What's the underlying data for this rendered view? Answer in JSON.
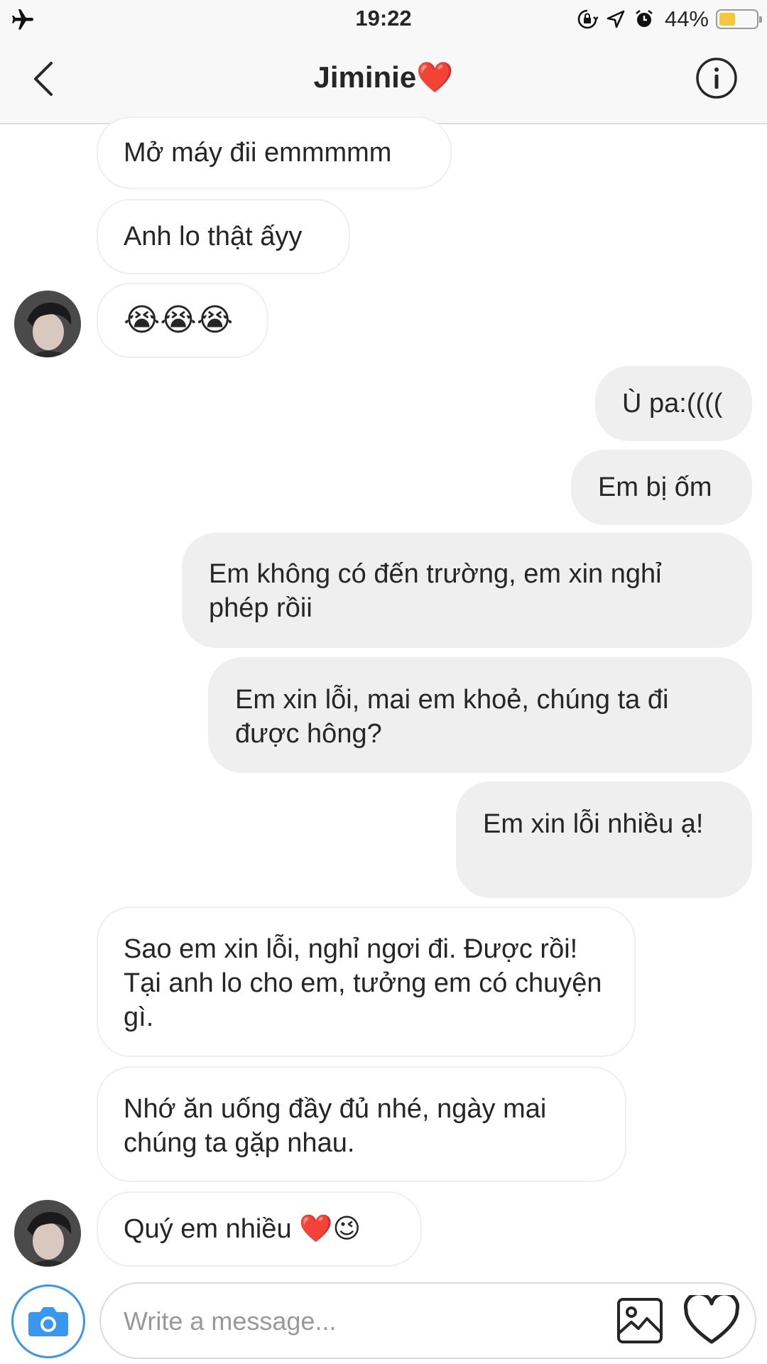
{
  "status_bar": {
    "time": "19:22",
    "battery_text": "44%",
    "battery_level": 0.44,
    "icons": [
      "airplane-icon",
      "orientation-lock-icon",
      "location-arrow-icon",
      "alarm-icon",
      "battery-icon"
    ]
  },
  "header": {
    "title": "Jiminie❤️",
    "back_icon": "chevron-left-icon",
    "info_icon": "info-icon"
  },
  "messages": [
    {
      "from": "them",
      "text": "Mở máy đii emmmmm"
    },
    {
      "from": "them",
      "text": "Anh lo thật ấyy"
    },
    {
      "from": "them",
      "text": "😭😭😭"
    },
    {
      "from": "me",
      "text": "Ù pa:(((("
    },
    {
      "from": "me",
      "text": "Em bị ốm"
    },
    {
      "from": "me",
      "text": "Em không có đến trường, em xin nghỉ phép rồii"
    },
    {
      "from": "me",
      "text": "Em xin lỗi, mai em khoẻ, chúng ta đi được hông?"
    },
    {
      "from": "me",
      "text": "Em xin lỗi nhiều ạ!"
    },
    {
      "from": "them",
      "text": "Sao em xin lỗi, nghỉ ngơi đi. Được rồi! Tại anh lo cho em, tưởng em có chuyện gì."
    },
    {
      "from": "them",
      "text": "Nhớ ăn uống đầy đủ nhé, ngày mai chúng ta gặp nhau."
    },
    {
      "from": "them",
      "text": "Quý em nhiều ❤️😉"
    }
  ],
  "composer": {
    "placeholder": "Write a message...",
    "value": "",
    "camera_icon": "camera-icon",
    "gallery_icon": "image-gallery-icon",
    "like_icon": "heart-icon"
  },
  "colors": {
    "accent": "#3897f0",
    "outgoing_bubble": "#efefef",
    "battery": "#f5c73b"
  }
}
